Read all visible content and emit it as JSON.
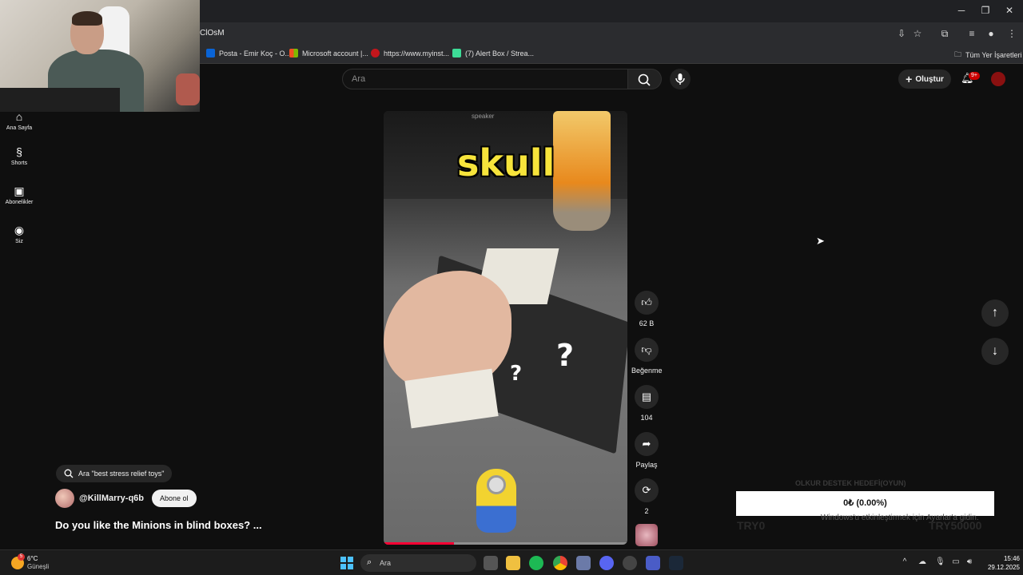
{
  "browser": {
    "url_fragment": "ClOsM",
    "bookmarks": [
      {
        "label": "Posta - Emir Koç - O...",
        "color": "#0a64d6"
      },
      {
        "label": "Microsoft account |...",
        "color": "#f25022"
      },
      {
        "label": "https://www.myinst...",
        "color": "#c4161c"
      },
      {
        "label": "(7) Alert Box / Strea...",
        "color": "#3ddc97"
      }
    ],
    "all_bookmarks": "Tüm Yer İşaretleri"
  },
  "youtube": {
    "search_placeholder": "Ara",
    "create_label": "Oluştur",
    "notifications_badge": "9+",
    "nav": [
      {
        "label": "Ana Sayfa",
        "icon": "home-icon"
      },
      {
        "label": "Shorts",
        "icon": "shorts-icon"
      },
      {
        "label": "Abonelikler",
        "icon": "subscriptions-icon"
      },
      {
        "label": "Siz",
        "icon": "you-icon"
      }
    ]
  },
  "short": {
    "overlay_text": "skull",
    "speaker_text": "speaker",
    "related_search": "Ara \"best stress relief toys\"",
    "channel": "@KillMarry-q6b",
    "subscribe_label": "Abone ol",
    "title": "Do you like the Minions in blind boxes? ...",
    "progress_fraction": 0.29,
    "actions": {
      "likes": "62 B",
      "dislike_label": "Beğenme",
      "comments": "104",
      "share_label": "Paylaş",
      "remix_count": "2"
    }
  },
  "overlay_widget": {
    "goal_title": "OLKUR DESTEK HEDEFİ(OYUN)",
    "progress_text": "0₺ (0.00%)",
    "left_amount": "TRY0",
    "right_amount": "TRY50000",
    "activation_text": "Windows'u etkinleştirmek için Ayarlar'a gidin."
  },
  "taskbar": {
    "temperature": "6°C",
    "condition": "Güneşli",
    "weather_badge": "5",
    "search_placeholder": "Ara",
    "time": "15:46",
    "date": "29.12.2025"
  }
}
